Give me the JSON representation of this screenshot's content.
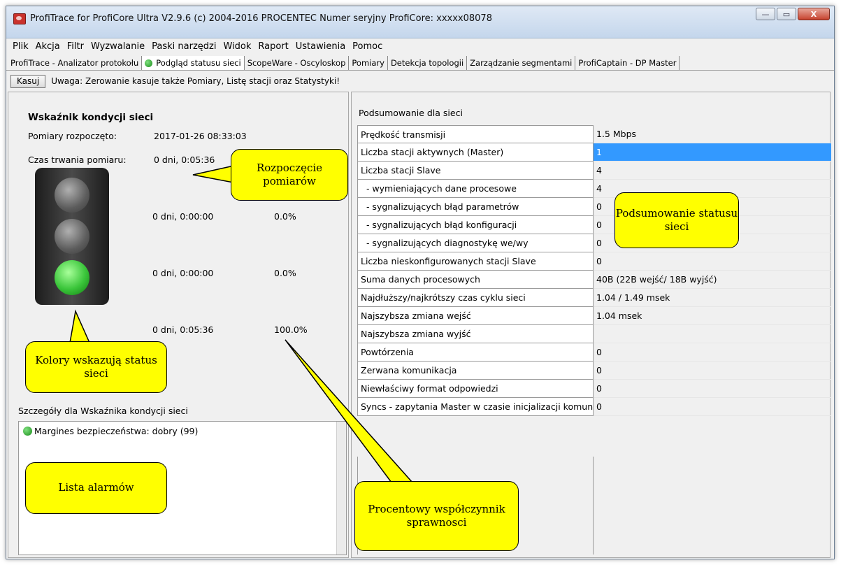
{
  "window": {
    "title": "ProfiTrace for ProfiCore Ultra V2.9.6 (c) 2004-2016 PROCENTEC  Numer seryjny ProfiCore: xxxxx08078",
    "minimize": "—",
    "maximize": "▭",
    "close": "X"
  },
  "menu": [
    "Plik",
    "Akcja",
    "Filtr",
    "Wyzwalanie",
    "Paski narzędzi",
    "Widok",
    "Raport",
    "Ustawienia",
    "Pomoc"
  ],
  "tabs": [
    {
      "label": "ProfiTrace - Analizator protokołu",
      "active": false
    },
    {
      "label": "Podgląd statusu sieci",
      "active": true
    },
    {
      "label": "ScopeWare - Oscyloskop",
      "active": false
    },
    {
      "label": "Pomiary",
      "active": false
    },
    {
      "label": "Detekcja topologii",
      "active": false
    },
    {
      "label": "Zarządzanie segmentami",
      "active": false
    },
    {
      "label": "ProfiCaptain - DP Master",
      "active": false
    }
  ],
  "toolbar": {
    "reset_label": "Kasuj",
    "warning": "Uwaga: Zerowanie kasuje także Pomiary, Listę stacji oraz Statystyki!"
  },
  "health": {
    "title": "Wskaźnik kondycji sieci",
    "start_label": "Pomiary rozpoczęto:",
    "start_value": "2017-01-26 08:33:03",
    "duration_label": "Czas trwania pomiaru:",
    "duration_value": "0 dni, 0:05:36",
    "lights": [
      {
        "state": "red",
        "active": false,
        "time": "0 dni, 0:00:00",
        "percent": "0.0%"
      },
      {
        "state": "yellow",
        "active": false,
        "time": "0 dni, 0:00:00",
        "percent": "0.0%"
      },
      {
        "state": "green",
        "active": true,
        "time": "0 dni, 0:05:36",
        "percent": "100.0%"
      }
    ]
  },
  "details": {
    "title": "Szczegóły dla Wskaźnika kondycji sieci",
    "alarms": [
      "Margines bezpieczeństwa: dobry (99)"
    ]
  },
  "summary": {
    "title": "Podsumowanie dla sieci",
    "rows": [
      {
        "label": "Prędkość transmisji",
        "value": "1.5 Mbps"
      },
      {
        "label": "Liczba stacji aktywnych (Master)",
        "value": "1",
        "selected": true
      },
      {
        "label": "Liczba stacji Slave",
        "value": "4"
      },
      {
        "label": "  - wymieniających dane procesowe",
        "value": "4"
      },
      {
        "label": "  - sygnalizujących błąd parametrów",
        "value": "0"
      },
      {
        "label": "  - sygnalizujących błąd konfiguracji",
        "value": "0"
      },
      {
        "label": "  - sygnalizujących diagnostykę we/wy",
        "value": "0"
      },
      {
        "label": "Liczba nieskonfigurowanych stacji Slave",
        "value": "0"
      },
      {
        "label": "Suma danych procesowych",
        "value": "40B (22B wejść/ 18B wyjść)"
      },
      {
        "label": "Najdłuższy/najkrótszy czas cyklu sieci",
        "value": "1.04 / 1.49 msek"
      },
      {
        "label": "Najszybsza zmiana wejść",
        "value": "1.04 msek"
      },
      {
        "label": "Najszybsza zmiana wyjść",
        "value": ""
      },
      {
        "label": "Powtórzenia",
        "value": "0"
      },
      {
        "label": "Zerwana komunikacja",
        "value": "0"
      },
      {
        "label": "Niewłaściwy format odpowiedzi",
        "value": "0"
      },
      {
        "label": "Syncs - zapytania Master w czasie inicjalizacji komunikacji",
        "value": "0"
      }
    ]
  },
  "callouts": {
    "start": "Rozpoczęcie pomiarów",
    "colors": "Kolory wskazują status sieci",
    "alarms": "Lista alarmów",
    "summary": "Podsumowanie statusu sieci",
    "efficiency": "Procentowy współczynnik sprawnosci"
  },
  "colors": {
    "selection": "#3399ff",
    "callout": "#ffff00",
    "green_lamp": "#3ac53a"
  }
}
